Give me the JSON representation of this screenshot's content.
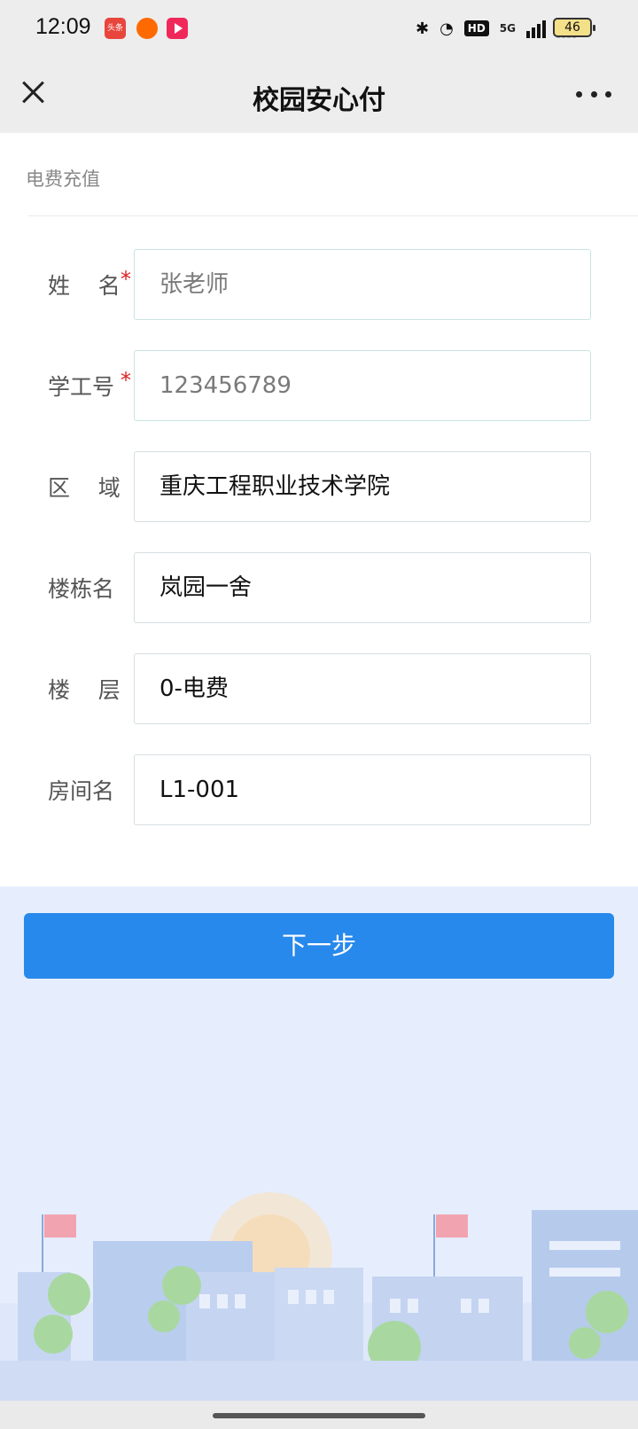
{
  "status_bar": {
    "time": "12:09",
    "notification_icons": [
      "toutiao-icon",
      "orange-app-icon",
      "video-app-icon"
    ],
    "toutiao_label": "头条",
    "network_label": "5G",
    "hd_label": "HD",
    "battery_level": "46"
  },
  "nav": {
    "title": "校园安心付"
  },
  "form": {
    "section_title": "电费充值",
    "fields": [
      {
        "label": "姓    名",
        "required": true,
        "value": "张老师",
        "is_placeholder": true
      },
      {
        "label": "学工号",
        "required": true,
        "value": "123456789",
        "is_placeholder": true
      },
      {
        "label": "区    域",
        "required": false,
        "value": "重庆工程职业技术学院",
        "is_placeholder": false
      },
      {
        "label": "楼栋名",
        "required": false,
        "value": "岚园一舍",
        "is_placeholder": false
      },
      {
        "label": "楼    层",
        "required": false,
        "value": "0-电费",
        "is_placeholder": false
      },
      {
        "label": "房间名",
        "required": false,
        "value": "L1-001",
        "is_placeholder": false
      }
    ],
    "required_mark": "*"
  },
  "actions": {
    "next_label": "下一步"
  },
  "colors": {
    "primary": "#2889ec",
    "required": "#e02020",
    "page_bg": "#e6eefd"
  }
}
